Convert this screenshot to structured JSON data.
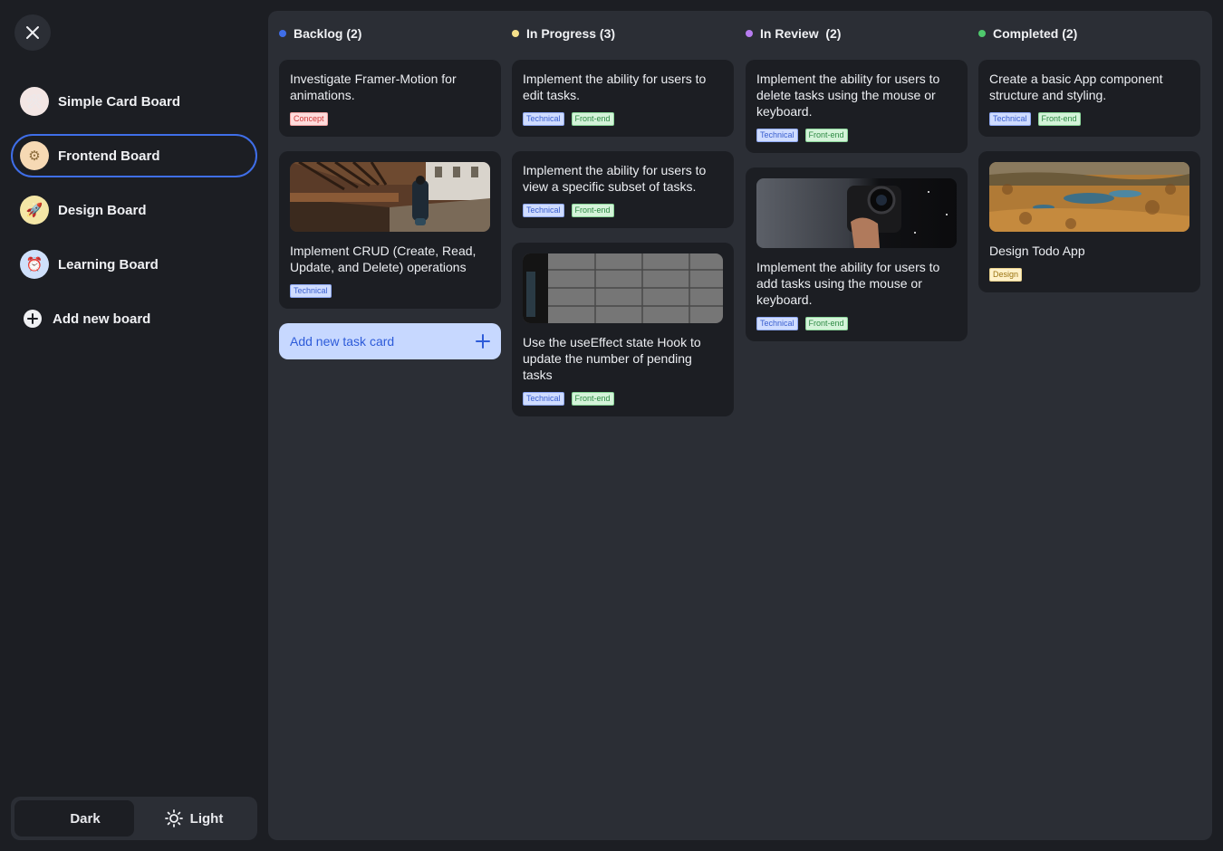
{
  "sidebar": {
    "boards": [
      {
        "label": "Simple Card Board",
        "emoji": "🛠",
        "bg": "#f3e6e4"
      },
      {
        "label": "Frontend Board",
        "emoji": "⚙",
        "bg": "#f6d9b4"
      },
      {
        "label": "Design Board",
        "emoji": "🚀",
        "bg": "#f4e6a6"
      },
      {
        "label": "Learning Board",
        "emoji": "⏰",
        "bg": "#cfe0fb"
      }
    ],
    "active_board": "Frontend Board",
    "add_board_label": "Add new board"
  },
  "theme": {
    "dark_label": "Dark",
    "light_label": "Light",
    "selected": "Dark"
  },
  "columns": [
    {
      "title": "Backlog (2)",
      "dot_color": "#3f6ee8",
      "cards": [
        {
          "title": "Investigate Framer-Motion for animations.",
          "tags": [
            "Concept"
          ]
        },
        {
          "title": "Implement CRUD (Create, Read, Update, and Delete) operations",
          "tags": [
            "Technical"
          ],
          "image": "covered-bridge"
        }
      ],
      "add_task_label": "Add new task card"
    },
    {
      "title": "In Progress (3)",
      "dot_color": "#f5e08a",
      "cards": [
        {
          "title": "Implement the ability for users to edit tasks.",
          "tags": [
            "Technical",
            "Front-end"
          ]
        },
        {
          "title": "Implement the ability for users to view a specific subset of tasks.",
          "tags": [
            "Technical",
            "Front-end"
          ]
        },
        {
          "title": "Use the useEffect state Hook to update the number of pending tasks",
          "tags": [
            "Technical",
            "Front-end"
          ],
          "image": "stone-wall"
        }
      ]
    },
    {
      "title": "In Review  (2)",
      "dot_color": "#b77cf0",
      "cards": [
        {
          "title": "Implement the ability for users to delete tasks using the mouse or keyboard.",
          "tags": [
            "Technical",
            "Front-end"
          ]
        },
        {
          "title": "Implement the ability for users to add tasks using the mouse or keyboard.",
          "tags": [
            "Technical",
            "Front-end"
          ],
          "image": "camera-hand"
        }
      ]
    },
    {
      "title": "Completed (2)",
      "dot_color": "#4fc96d",
      "cards": [
        {
          "title": "Create a basic App component structure and styling.",
          "tags": [
            "Technical",
            "Front-end"
          ]
        },
        {
          "title": "Design Todo App",
          "tags": [
            "Design"
          ],
          "image": "autumn-landscape"
        }
      ]
    }
  ]
}
